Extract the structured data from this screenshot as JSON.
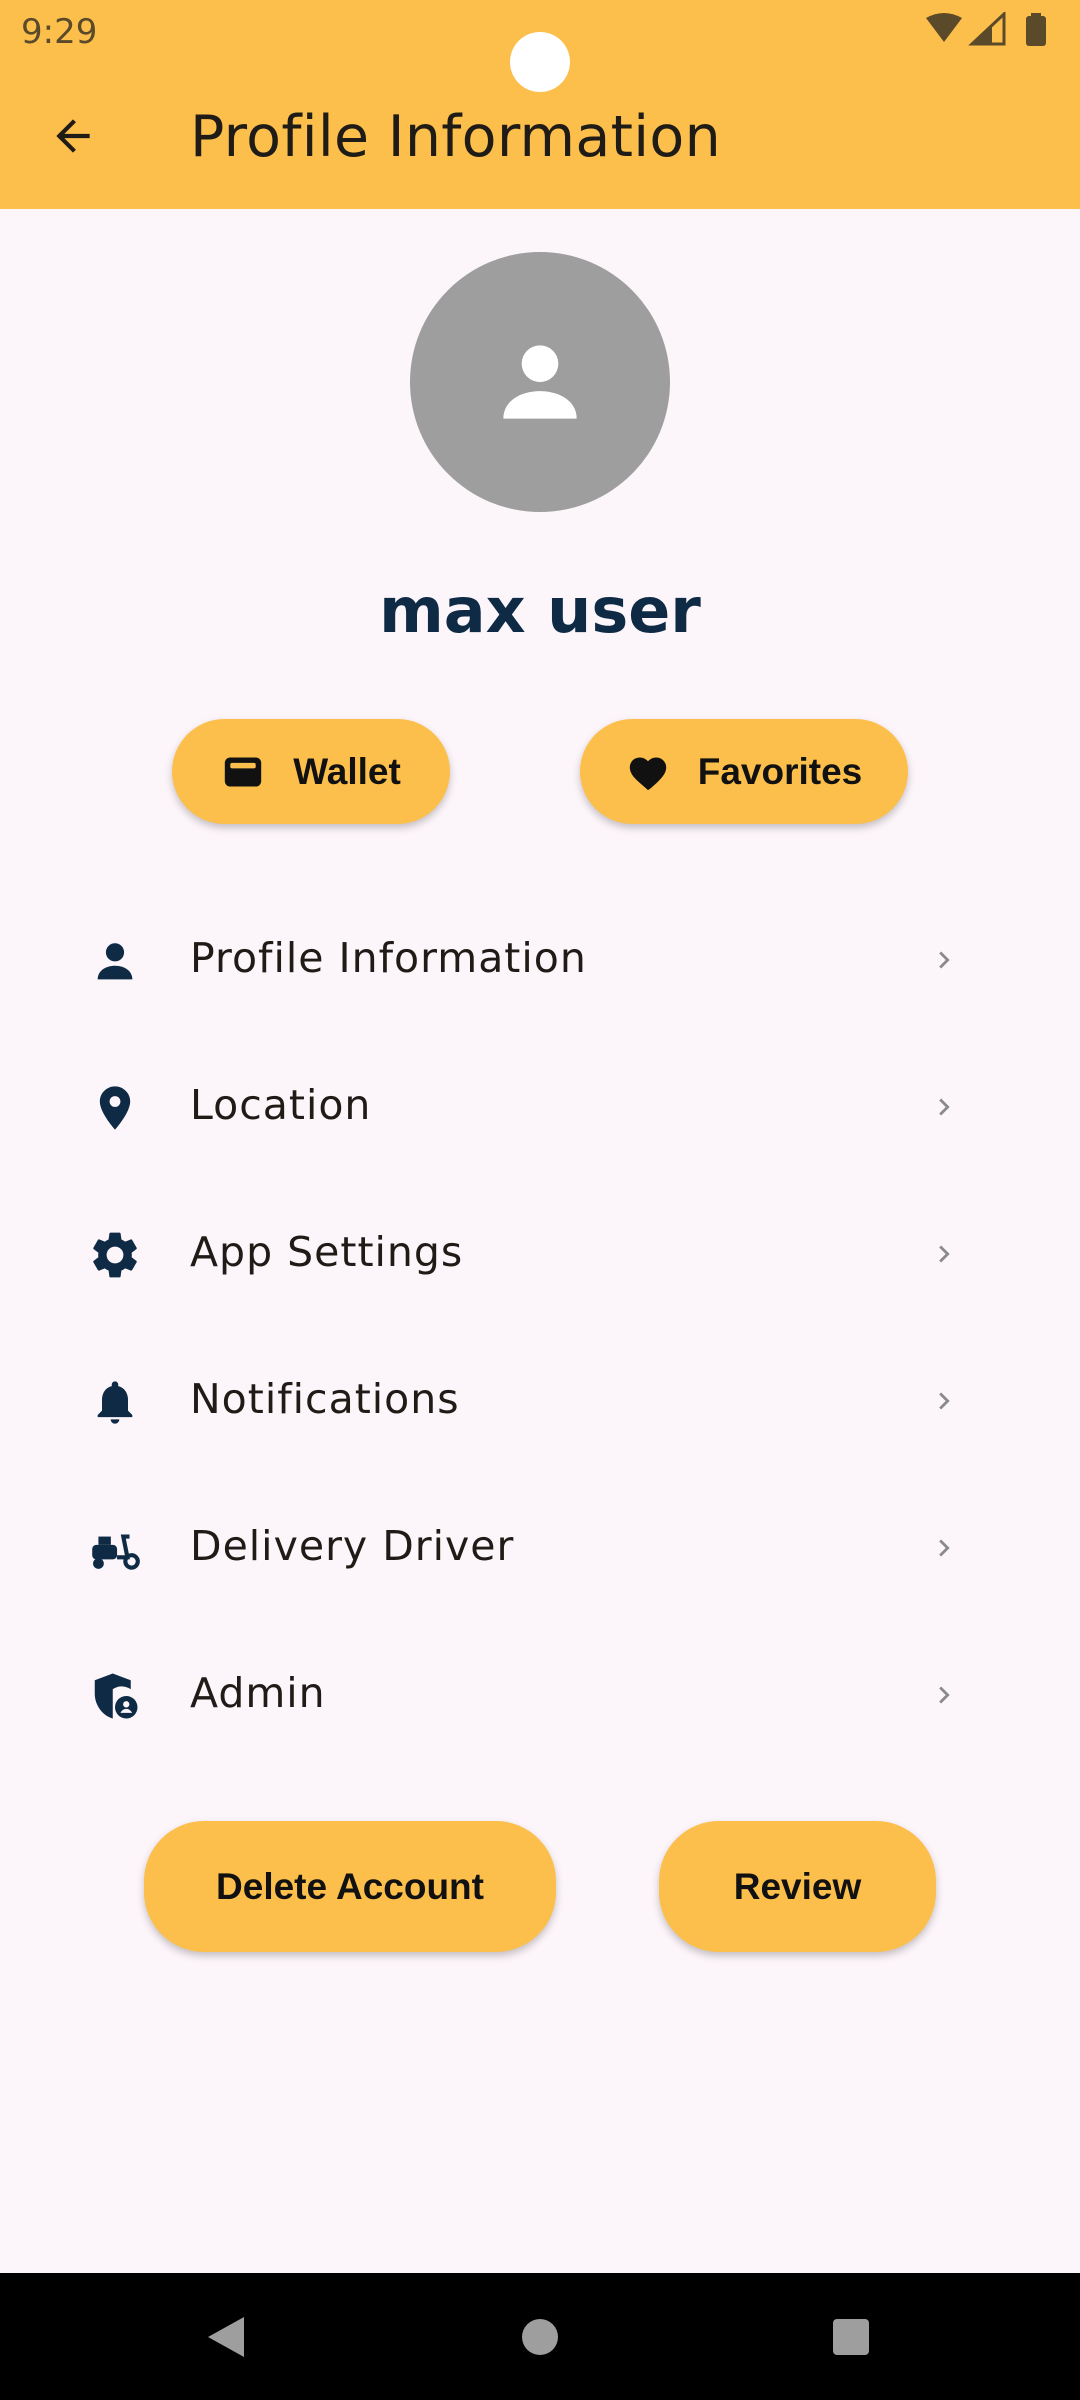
{
  "status_bar": {
    "time": "9:29",
    "icons": [
      "wifi-icon",
      "signal-icon",
      "battery-icon"
    ]
  },
  "app_bar": {
    "back_icon": "arrow-back-icon",
    "title": "Profile Information"
  },
  "profile": {
    "avatar_icon": "person-icon",
    "name": "max user"
  },
  "quick_actions": [
    {
      "label": "Wallet",
      "icon": "wallet-icon"
    },
    {
      "label": "Favorites",
      "icon": "heart-icon"
    }
  ],
  "menu": {
    "items": [
      {
        "label": "Profile Information",
        "icon": "person-icon"
      },
      {
        "label": "Location",
        "icon": "location-pin-icon"
      },
      {
        "label": "App Settings",
        "icon": "gear-icon"
      },
      {
        "label": "Notifications",
        "icon": "bell-icon"
      },
      {
        "label": "Delivery Driver",
        "icon": "scooter-icon"
      },
      {
        "label": "Admin",
        "icon": "admin-shield-icon"
      }
    ],
    "chevron_icon": "chevron-right-icon"
  },
  "bottom_actions": {
    "delete_label": "Delete Account",
    "review_label": "Review"
  },
  "nav_bar": {
    "icons": [
      "nav-back-icon",
      "nav-home-icon",
      "nav-recents-icon"
    ]
  },
  "colors": {
    "accent": "#FCBF4B",
    "background": "#FCF5FA",
    "icon_navy": "#0E2A45",
    "avatar_gray": "#9E9E9E"
  }
}
